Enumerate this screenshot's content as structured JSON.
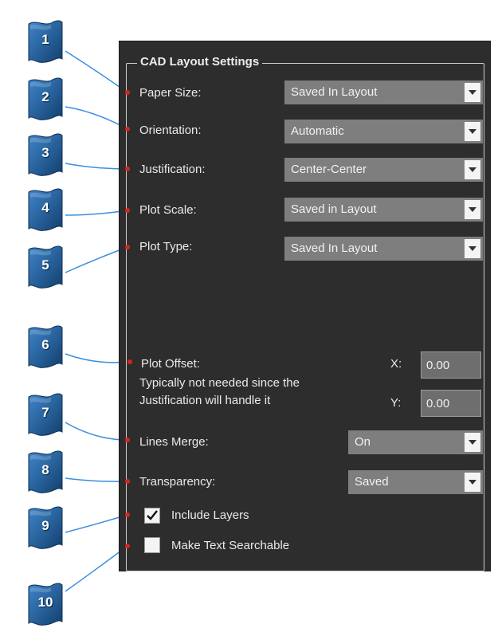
{
  "group_title": "CAD Layout Settings",
  "fields": {
    "paper_size": {
      "label": "Paper Size:",
      "value": "Saved In Layout"
    },
    "orientation": {
      "label": "Orientation:",
      "value": "Automatic"
    },
    "justification": {
      "label": "Justification:",
      "value": "Center-Center"
    },
    "plot_scale": {
      "label": "Plot Scale:",
      "value": "Saved in Layout"
    },
    "plot_type": {
      "label": "Plot Type:",
      "value": "Saved In Layout"
    },
    "lines_merge": {
      "label": "Lines Merge:",
      "value": "On"
    },
    "transparency": {
      "label": "Transparency:",
      "value": "Saved"
    }
  },
  "plot_offset": {
    "label": "Plot Offset:",
    "note_line1": "Typically not needed since the",
    "note_line2": "Justification will handle it",
    "x_label": "X:",
    "x_value": "0.00",
    "y_label": "Y:",
    "y_value": "0.00"
  },
  "checkboxes": {
    "include_layers": {
      "label": "Include Layers",
      "checked": true
    },
    "make_text_searchable": {
      "label": "Make Text Searchable",
      "checked": false
    }
  },
  "callouts": [
    "1",
    "2",
    "3",
    "4",
    "5",
    "6",
    "7",
    "8",
    "9",
    "10"
  ],
  "colors": {
    "panel": "#2d2d2d",
    "badge": "#1c5a96",
    "leader": "#3a8ee0",
    "marker": "#d42323"
  }
}
